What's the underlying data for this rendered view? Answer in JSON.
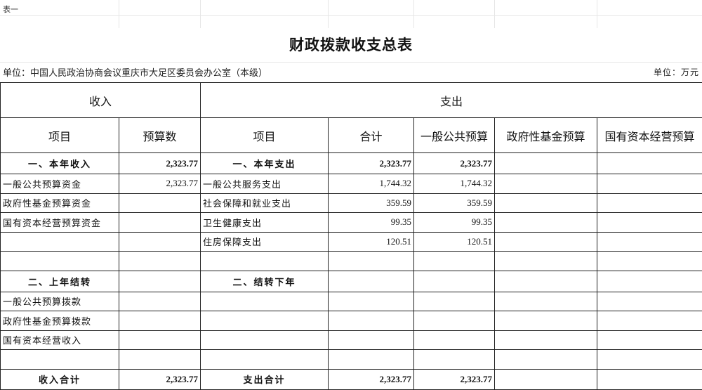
{
  "sheet_label": "表一",
  "title": "财政拨款收支总表",
  "unit_left": "单位：中国人民政治协商会议重庆市大足区委员会办公室（本级）",
  "unit_right": "单位：万元",
  "headers": {
    "income": "收入",
    "expense": "支出",
    "item": "项目",
    "budget": "预算数",
    "item2": "项目",
    "total": "合计",
    "general": "一般公共预算",
    "fund": "政府性基金预算",
    "state": "国有资本经营预算"
  },
  "rows": [
    {
      "inc_item": "一、本年收入",
      "inc_val": "2,323.77",
      "exp_item": "一、本年支出",
      "total": "2,323.77",
      "general": "2,323.77",
      "fund": "",
      "state": ""
    },
    {
      "inc_item": "一般公共预算资金",
      "inc_val": "2,323.77",
      "exp_item": "一般公共服务支出",
      "total": "1,744.32",
      "general": "1,744.32",
      "fund": "",
      "state": ""
    },
    {
      "inc_item": "政府性基金预算资金",
      "inc_val": "",
      "exp_item": "社会保障和就业支出",
      "total": "359.59",
      "general": "359.59",
      "fund": "",
      "state": ""
    },
    {
      "inc_item": "国有资本经营预算资金",
      "inc_val": "",
      "exp_item": "卫生健康支出",
      "total": "99.35",
      "general": "99.35",
      "fund": "",
      "state": ""
    },
    {
      "inc_item": "",
      "inc_val": "",
      "exp_item": "住房保障支出",
      "total": "120.51",
      "general": "120.51",
      "fund": "",
      "state": ""
    },
    {
      "inc_item": "",
      "inc_val": "",
      "exp_item": "",
      "total": "",
      "general": "",
      "fund": "",
      "state": ""
    },
    {
      "inc_item": "二、上年结转",
      "inc_val": "",
      "exp_item": "二、结转下年",
      "total": "",
      "general": "",
      "fund": "",
      "state": ""
    },
    {
      "inc_item": "一般公共预算拨款",
      "inc_val": "",
      "exp_item": "",
      "total": "",
      "general": "",
      "fund": "",
      "state": ""
    },
    {
      "inc_item": "政府性基金预算拨款",
      "inc_val": "",
      "exp_item": "",
      "total": "",
      "general": "",
      "fund": "",
      "state": ""
    },
    {
      "inc_item": "国有资本经营收入",
      "inc_val": "",
      "exp_item": "",
      "total": "",
      "general": "",
      "fund": "",
      "state": ""
    },
    {
      "inc_item": "",
      "inc_val": "",
      "exp_item": "",
      "total": "",
      "general": "",
      "fund": "",
      "state": ""
    }
  ],
  "totals": {
    "inc_label": "收入合计",
    "inc_val": "2,323.77",
    "exp_label": "支出合计",
    "total": "2,323.77",
    "general": "2,323.77",
    "fund": "",
    "state": ""
  }
}
